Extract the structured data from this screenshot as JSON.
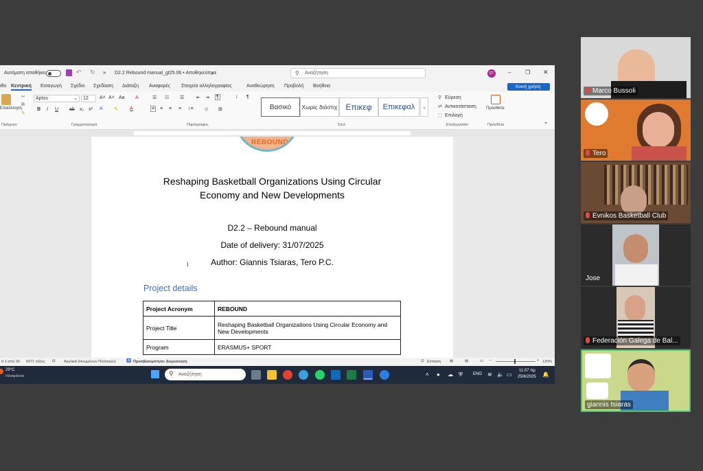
{
  "word": {
    "title_bar": {
      "autosave_label": "Αυτόματη αποθήκευση",
      "doc_title": "D2.2 Rebound manual_gt25.06 • Αποθηκεύτηκε",
      "search_placeholder": "Αναζήτηση",
      "user_initials": "GT"
    },
    "ribbon_tabs": [
      "ιθο",
      "Κεντρική",
      "Εισαγωγή",
      "Σχέδιο",
      "Σχεδίαση",
      "Διάταξη",
      "Αναφορές",
      "Στοιχεία αλληλογραφίας",
      "Αναθεώρηση",
      "Προβολή",
      "Βοήθεια"
    ],
    "share_button": "Κοινή χρήση",
    "font_name": "Aptos",
    "font_size": "12",
    "paste_label": "Επικόλληση",
    "styles": [
      "Βασικό",
      "Χωρίς διάστιχ",
      "Επικεφ",
      "Επικεφαλ"
    ],
    "find_label": "Εύρεση",
    "replace_label": "Αντικατάσταση",
    "select_label": "Επιλογή",
    "addins_label": "Πρόσθετα",
    "group_labels": [
      "Πρόχειρο",
      "Γραμματοσειρά",
      "Παράγραφος",
      "Στυλ",
      "Επεξεργασία",
      "Πρόσθετα"
    ],
    "document": {
      "logo_text": "REBOUND",
      "title_line1": "Reshaping Basketball Organizations Using Circular",
      "title_line2": "Economy and New Developments",
      "deliverable": "D2.2 – Rebound manual",
      "date": "Date of delivery: 31/07/2025",
      "author": "Author: Giannis Tsiaras, Tero P.C.",
      "section_heading": "Project details",
      "table": [
        {
          "label": "Project Acronym",
          "value": "REBOUND"
        },
        {
          "label": "Project Title",
          "value": "Reshaping Basketball Organizations Using Circular Economy and New Developments"
        },
        {
          "label": "Program",
          "value": "ERASMUS+ SPORT"
        }
      ]
    },
    "status": {
      "page": "α 1 από 26",
      "words": "5071 λέξεις",
      "language": "Αγγλικά (Ηνωμένων Πολιτειών)",
      "accessibility": "Προσβασιμότητα: Διερεύνηση",
      "focus": "Εστίαση",
      "zoom": "120%"
    }
  },
  "taskbar": {
    "temperature": "29°C",
    "weather": "Ηλιοφάνεια",
    "search_placeholder": "Αναζήτηση",
    "language": "ENG",
    "time": "11:07 πμ",
    "date": "25/6/2025"
  },
  "participants": [
    {
      "name": "Marco Bussoli",
      "muted": true
    },
    {
      "name": "Tero",
      "muted": true
    },
    {
      "name": "Evnikos Basketball Club",
      "muted": true
    },
    {
      "name": "Jose",
      "muted": false
    },
    {
      "name": "Federación Galega de Bal...",
      "muted": true
    },
    {
      "name": "giannis tsiaras",
      "muted": false
    }
  ],
  "colors": {
    "accent": "#1a66c8",
    "heading_blue": "#3a6fc4",
    "active_speaker": "#4fc76b",
    "taskbar": "#1f2a3a"
  }
}
